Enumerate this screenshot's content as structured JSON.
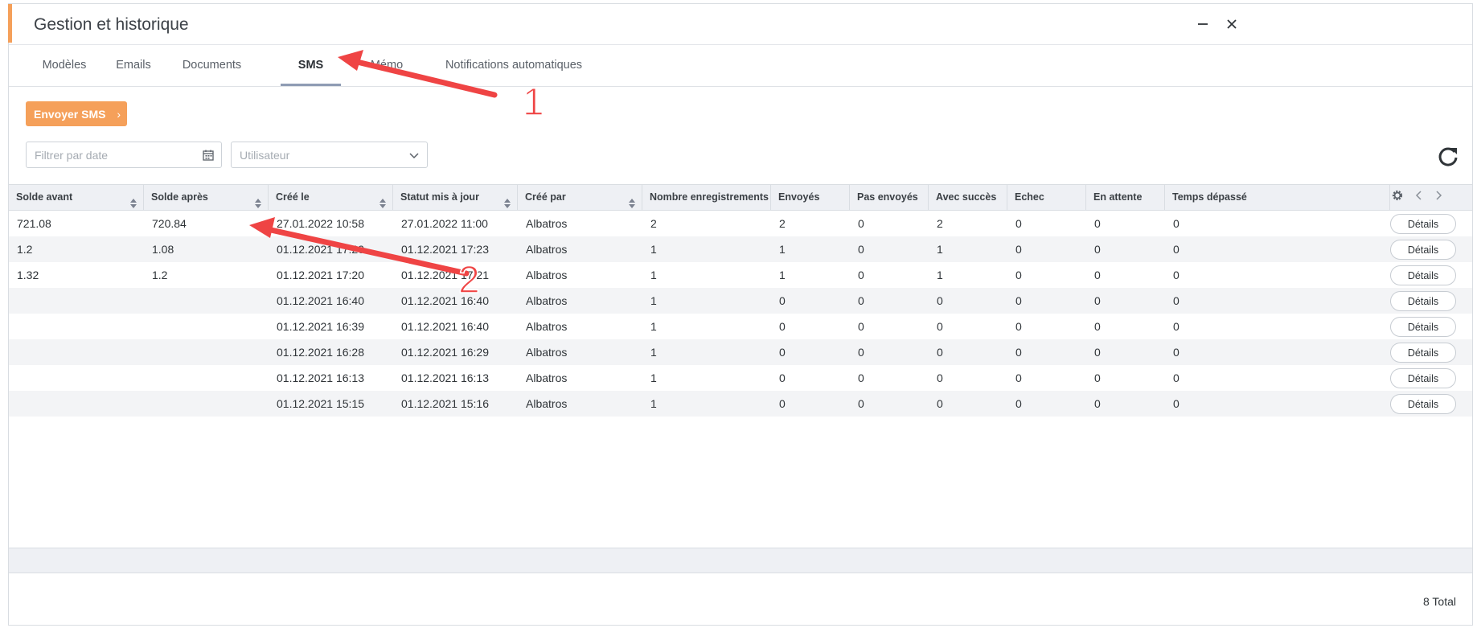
{
  "window": {
    "title": "Gestion et historique"
  },
  "tabs": [
    {
      "label": "Modèles",
      "active": false
    },
    {
      "label": "Emails",
      "active": false
    },
    {
      "label": "Documents",
      "active": false
    },
    {
      "label": "SMS",
      "active": true
    },
    {
      "label": "Mémo",
      "active": false
    },
    {
      "label": "Notifications automatiques",
      "active": false
    }
  ],
  "toolbar": {
    "send_label": "Envoyer SMS"
  },
  "filters": {
    "date_placeholder": "Filtrer par date",
    "user_placeholder": "Utilisateur"
  },
  "table": {
    "columns": [
      "Solde avant",
      "Solde après",
      "Créé le",
      "Statut mis à jour",
      "Créé par",
      "Nombre enregistrements",
      "Envoyés",
      "Pas envoyés",
      "Avec succès",
      "Echec",
      "En attente",
      "Temps dépassé"
    ],
    "details_label": "Détails",
    "rows": [
      [
        "721.08",
        "720.84",
        "27.01.2022 10:58",
        "27.01.2022 11:00",
        "Albatros",
        "2",
        "2",
        "0",
        "2",
        "0",
        "0",
        "0"
      ],
      [
        "1.2",
        "1.08",
        "01.12.2021 17:20",
        "01.12.2021 17:23",
        "Albatros",
        "1",
        "1",
        "0",
        "1",
        "0",
        "0",
        "0"
      ],
      [
        "1.32",
        "1.2",
        "01.12.2021 17:20",
        "01.12.2021 17:21",
        "Albatros",
        "1",
        "1",
        "0",
        "1",
        "0",
        "0",
        "0"
      ],
      [
        "",
        "",
        "01.12.2021 16:40",
        "01.12.2021 16:40",
        "Albatros",
        "1",
        "0",
        "0",
        "0",
        "0",
        "0",
        "0"
      ],
      [
        "",
        "",
        "01.12.2021 16:39",
        "01.12.2021 16:40",
        "Albatros",
        "1",
        "0",
        "0",
        "0",
        "0",
        "0",
        "0"
      ],
      [
        "",
        "",
        "01.12.2021 16:28",
        "01.12.2021 16:29",
        "Albatros",
        "1",
        "0",
        "0",
        "0",
        "0",
        "0",
        "0"
      ],
      [
        "",
        "",
        "01.12.2021 16:13",
        "01.12.2021 16:13",
        "Albatros",
        "1",
        "0",
        "0",
        "0",
        "0",
        "0",
        "0"
      ],
      [
        "",
        "",
        "01.12.2021 15:15",
        "01.12.2021 15:16",
        "Albatros",
        "1",
        "0",
        "0",
        "0",
        "0",
        "0",
        "0"
      ]
    ]
  },
  "footer": {
    "total": "8 Total"
  },
  "annotations": [
    {
      "label": "1"
    },
    {
      "label": "2"
    }
  ],
  "colors": {
    "accent": "#f5a05a",
    "annotation": "#ef4444",
    "active_tab_underline": "#8f9cb4"
  },
  "icons": [
    "minimize-icon",
    "close-icon",
    "calendar-icon",
    "chevron-down-icon",
    "refresh-icon",
    "sort-icon",
    "gear-icon",
    "chevron-left-icon",
    "chevron-right-icon"
  ]
}
